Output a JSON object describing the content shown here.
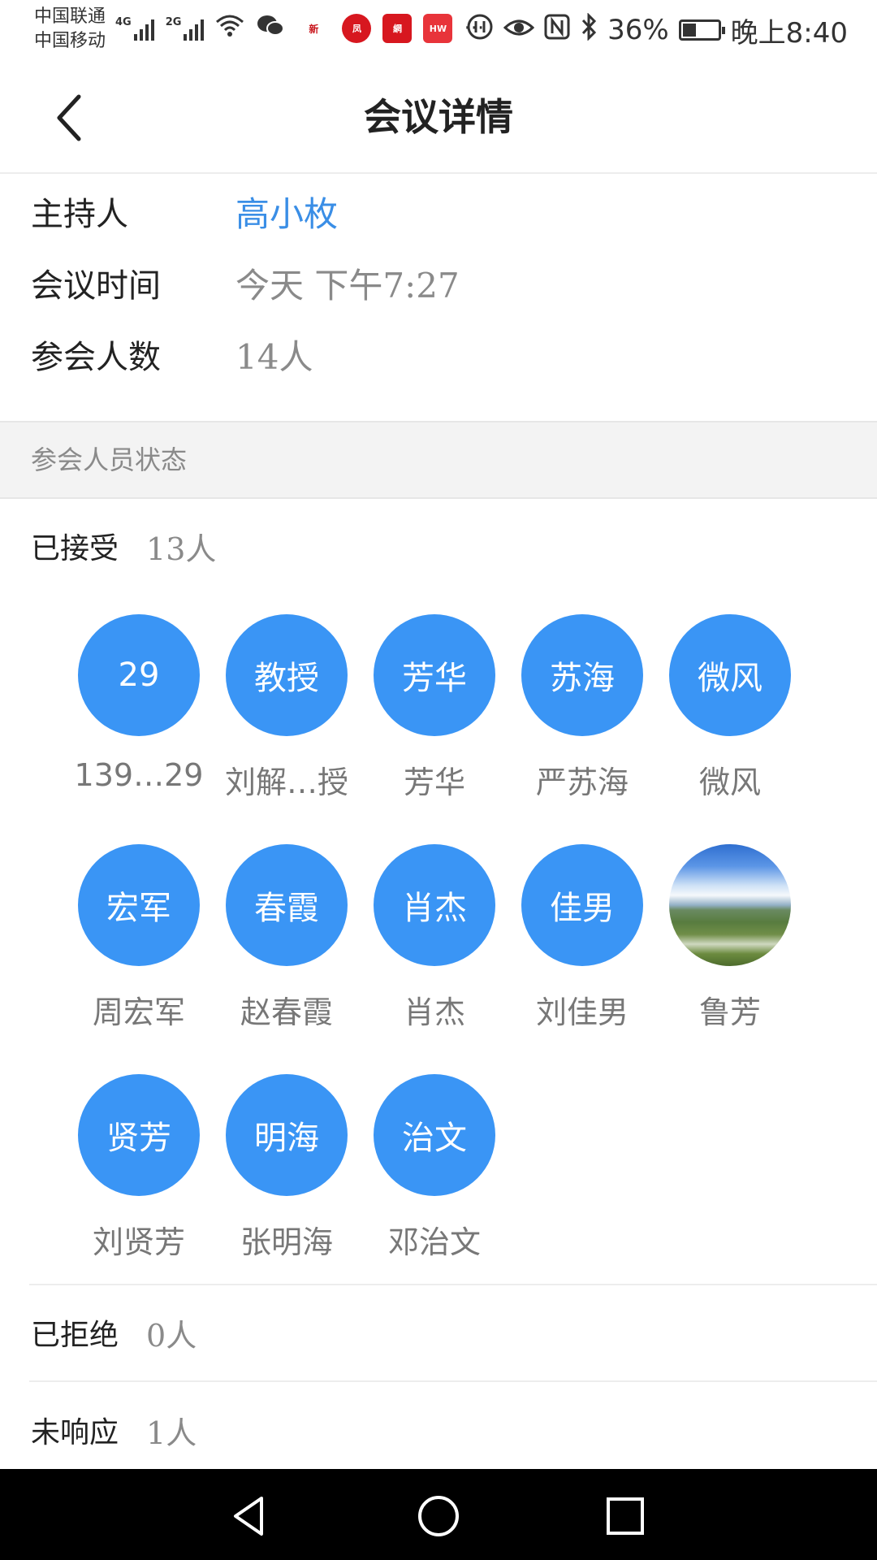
{
  "status_bar": {
    "carrier_1": "中国联通",
    "carrier_2": "中国移动",
    "net_1": "4G",
    "net_2": "2G",
    "battery_percent": "36%",
    "battery_level": 0.36,
    "time": "晚上8:40",
    "app_icons": [
      "wifi-icon",
      "wechat-icon",
      "news-icon",
      "phoenix-icon",
      "netease-icon",
      "huawei-icon",
      "more-icon",
      "data-icon",
      "eye-icon",
      "nfc-icon",
      "bluetooth-icon"
    ]
  },
  "header": {
    "title": "会议详情",
    "back_icon": "chevron-left-icon"
  },
  "info": {
    "host_label": "主持人",
    "host_value": "高小枚",
    "time_label": "会议时间",
    "time_value": "今天 下午7:27",
    "count_label": "参会人数",
    "count_value": "14人"
  },
  "section_title": "参会人员状态",
  "accepted": {
    "label": "已接受",
    "count": "13人",
    "people": [
      {
        "initials": "29",
        "name": "139…29"
      },
      {
        "initials": "教授",
        "name": "刘解…授"
      },
      {
        "initials": "芳华",
        "name": "芳华"
      },
      {
        "initials": "苏海",
        "name": "严苏海"
      },
      {
        "initials": "微风",
        "name": "微风"
      },
      {
        "initials": "宏军",
        "name": "周宏军"
      },
      {
        "initials": "春霞",
        "name": "赵春霞"
      },
      {
        "initials": "肖杰",
        "name": "肖杰"
      },
      {
        "initials": "佳男",
        "name": "刘佳男"
      },
      {
        "initials": "",
        "name": "鲁芳",
        "photo": true
      },
      {
        "initials": "贤芳",
        "name": "刘贤芳"
      },
      {
        "initials": "明海",
        "name": "张明海"
      },
      {
        "initials": "治文",
        "name": "邓治文"
      }
    ]
  },
  "rejected": {
    "label": "已拒绝",
    "count": "0人"
  },
  "no_response": {
    "label": "未响应",
    "count": "1人"
  },
  "colors": {
    "accent": "#3a95f5",
    "link": "#3a8ee6",
    "nav_bg": "#000000"
  }
}
